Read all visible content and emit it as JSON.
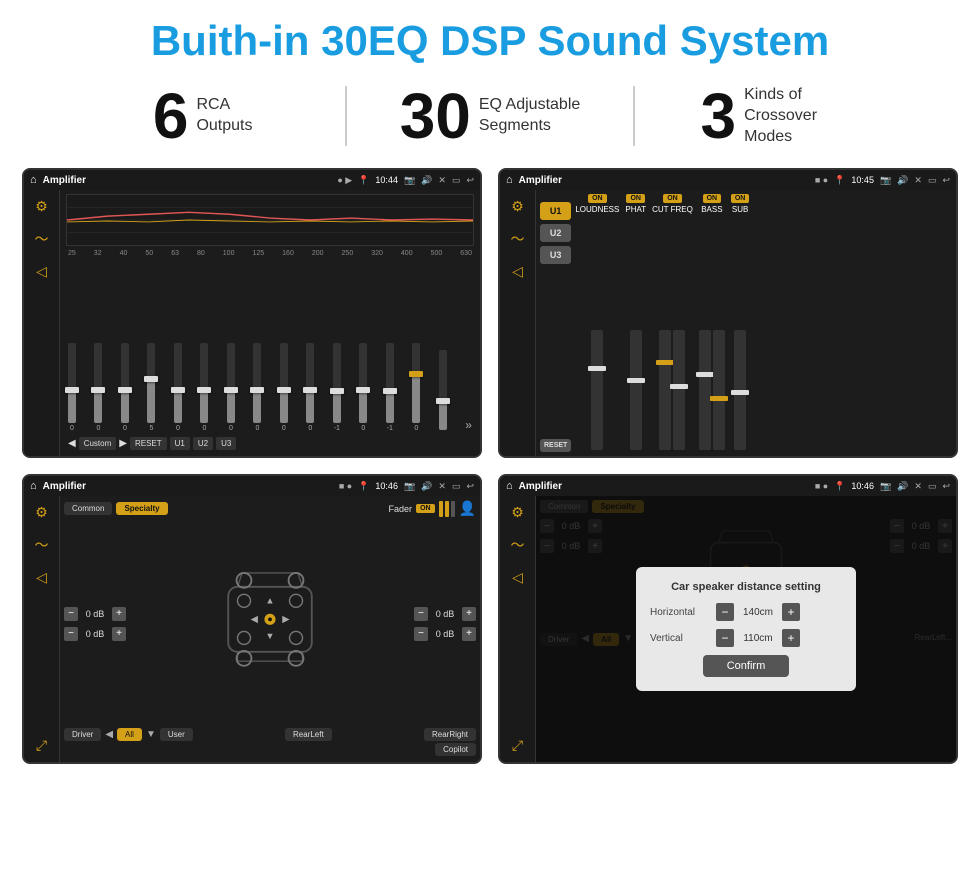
{
  "page": {
    "title": "Buith-in 30EQ DSP Sound System",
    "stats": [
      {
        "number": "6",
        "text": "RCA\nOutputs"
      },
      {
        "number": "30",
        "text": "EQ Adjustable\nSegments"
      },
      {
        "number": "3",
        "text": "Kinds of\nCrossover Modes"
      }
    ],
    "screens": [
      {
        "id": "eq-screen",
        "status_bar": {
          "title": "Amplifier",
          "time": "10:44"
        }
      },
      {
        "id": "crossover-screen",
        "status_bar": {
          "title": "Amplifier",
          "time": "10:45"
        }
      },
      {
        "id": "fader-screen",
        "status_bar": {
          "title": "Amplifier",
          "time": "10:46"
        }
      },
      {
        "id": "dialog-screen",
        "status_bar": {
          "title": "Amplifier",
          "time": "10:46"
        },
        "dialog": {
          "title": "Car speaker distance setting",
          "horizontal_label": "Horizontal",
          "horizontal_value": "140cm",
          "vertical_label": "Vertical",
          "vertical_value": "110cm",
          "confirm_label": "Confirm"
        }
      }
    ],
    "eq": {
      "frequencies": [
        "25",
        "32",
        "40",
        "50",
        "63",
        "80",
        "100",
        "125",
        "160",
        "200",
        "250",
        "320",
        "400",
        "500",
        "630"
      ],
      "values": [
        "0",
        "0",
        "0",
        "5",
        "0",
        "0",
        "0",
        "0",
        "0",
        "0",
        "-1",
        "0",
        "-1",
        "",
        ""
      ],
      "bottom_buttons": [
        "Custom",
        "RESET",
        "U1",
        "U2",
        "U3"
      ]
    },
    "crossover": {
      "channels": [
        "U1",
        "U2",
        "U3"
      ],
      "sections": [
        "LOUDNESS",
        "PHAT",
        "CUT FREQ",
        "BASS",
        "SUB"
      ],
      "on_label": "ON",
      "reset_label": "RESET"
    },
    "fader": {
      "tabs": [
        "Common",
        "Specialty"
      ],
      "fader_label": "Fader",
      "on_label": "ON",
      "db_values": [
        "0 dB",
        "0 dB",
        "0 dB",
        "0 dB"
      ],
      "bottom_buttons": [
        "Driver",
        "All",
        "User",
        "RearLeft",
        "RearRight",
        "Copilot"
      ]
    },
    "dialog_confirm": "Confirm"
  }
}
